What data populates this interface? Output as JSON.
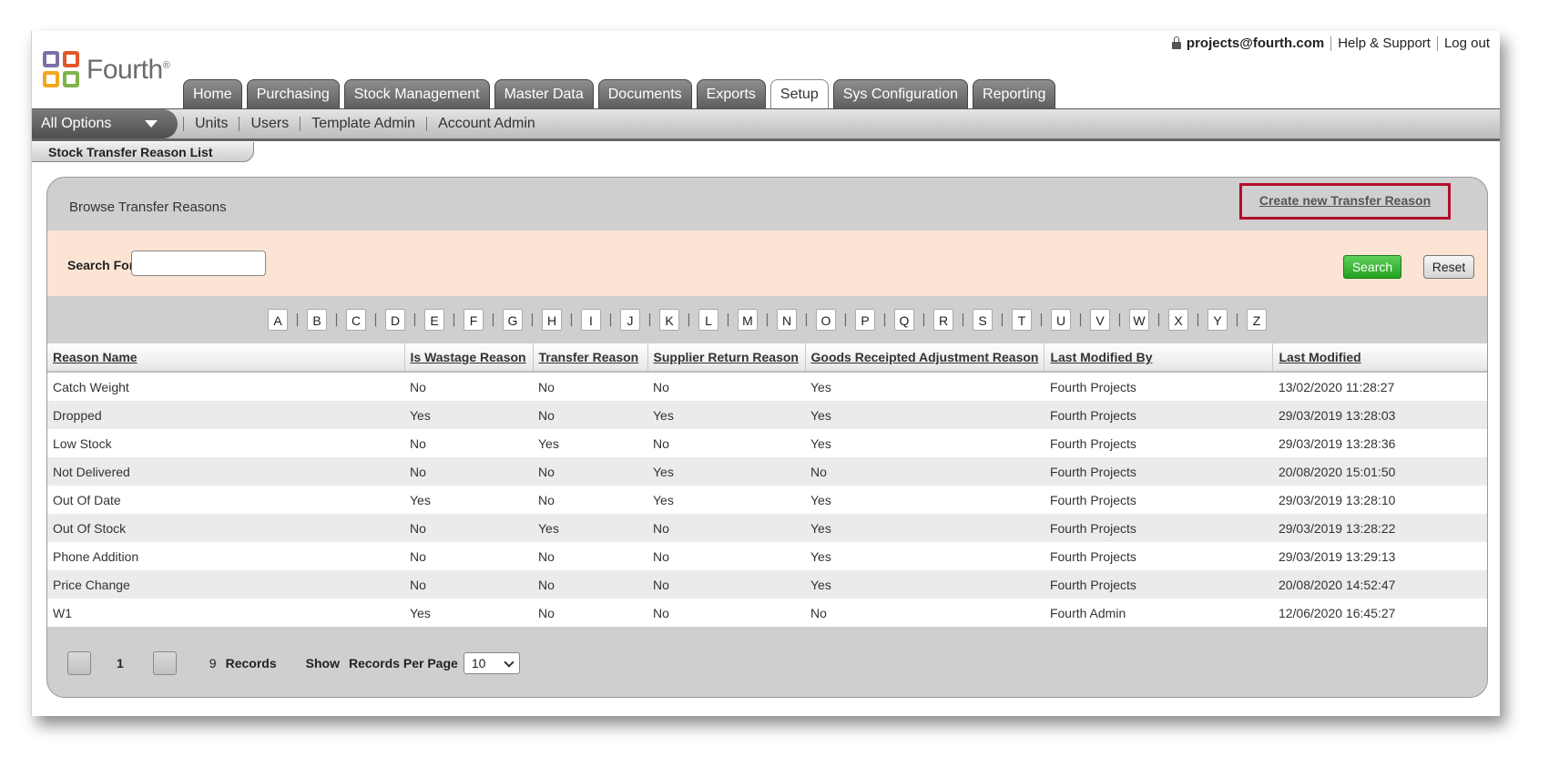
{
  "header": {
    "logo_text": "Fourth",
    "user": "projects@fourth.com",
    "help": "Help & Support",
    "logout": "Log out"
  },
  "tabs": [
    "Home",
    "Purchasing",
    "Stock Management",
    "Master Data",
    "Documents",
    "Exports",
    "Setup",
    "Sys Configuration",
    "Reporting"
  ],
  "active_tab": "Setup",
  "subnav": {
    "all_options": "All Options",
    "items": [
      "Units",
      "Users",
      "Template Admin",
      "Account Admin"
    ]
  },
  "page_tab": "Stock Transfer Reason List",
  "panel": {
    "title": "Browse Transfer Reasons",
    "create_link": "Create new Transfer Reason",
    "search_label": "Search For",
    "search_value": "",
    "search_button": "Search",
    "reset_button": "Reset"
  },
  "letters": [
    "A",
    "B",
    "C",
    "D",
    "E",
    "F",
    "G",
    "H",
    "I",
    "J",
    "K",
    "L",
    "M",
    "N",
    "O",
    "P",
    "Q",
    "R",
    "S",
    "T",
    "U",
    "V",
    "W",
    "X",
    "Y",
    "Z"
  ],
  "table": {
    "columns": [
      "Reason Name",
      "Is Wastage Reason",
      "Transfer Reason",
      "Supplier Return Reason",
      "Goods Receipted Adjustment Reason",
      "Last Modified By",
      "Last Modified"
    ],
    "rows": [
      [
        "Catch Weight",
        "No",
        "No",
        "No",
        "Yes",
        "Fourth Projects",
        "13/02/2020 11:28:27"
      ],
      [
        "Dropped",
        "Yes",
        "No",
        "Yes",
        "Yes",
        "Fourth Projects",
        "29/03/2019 13:28:03"
      ],
      [
        "Low Stock",
        "No",
        "Yes",
        "No",
        "Yes",
        "Fourth Projects",
        "29/03/2019 13:28:36"
      ],
      [
        "Not Delivered",
        "No",
        "No",
        "Yes",
        "No",
        "Fourth Projects",
        "20/08/2020 15:01:50"
      ],
      [
        "Out Of Date",
        "Yes",
        "No",
        "Yes",
        "Yes",
        "Fourth Projects",
        "29/03/2019 13:28:10"
      ],
      [
        "Out Of Stock",
        "No",
        "Yes",
        "No",
        "Yes",
        "Fourth Projects",
        "29/03/2019 13:28:22"
      ],
      [
        "Phone Addition",
        "No",
        "No",
        "No",
        "Yes",
        "Fourth Projects",
        "29/03/2019 13:29:13"
      ],
      [
        "Price Change",
        "No",
        "No",
        "No",
        "Yes",
        "Fourth Projects",
        "20/08/2020 14:52:47"
      ],
      [
        "W1",
        "Yes",
        "No",
        "No",
        "No",
        "Fourth Admin",
        "12/06/2020 16:45:27"
      ]
    ]
  },
  "pager": {
    "page": "1",
    "count": "9",
    "records_label": "Records",
    "show_label": "Show",
    "rpp_label": "Records Per Page",
    "rpp_value": "10"
  },
  "colors": {
    "highlight": "#b50d2c",
    "search_green": "#23a11f",
    "search_bg": "#fbe4d3"
  }
}
